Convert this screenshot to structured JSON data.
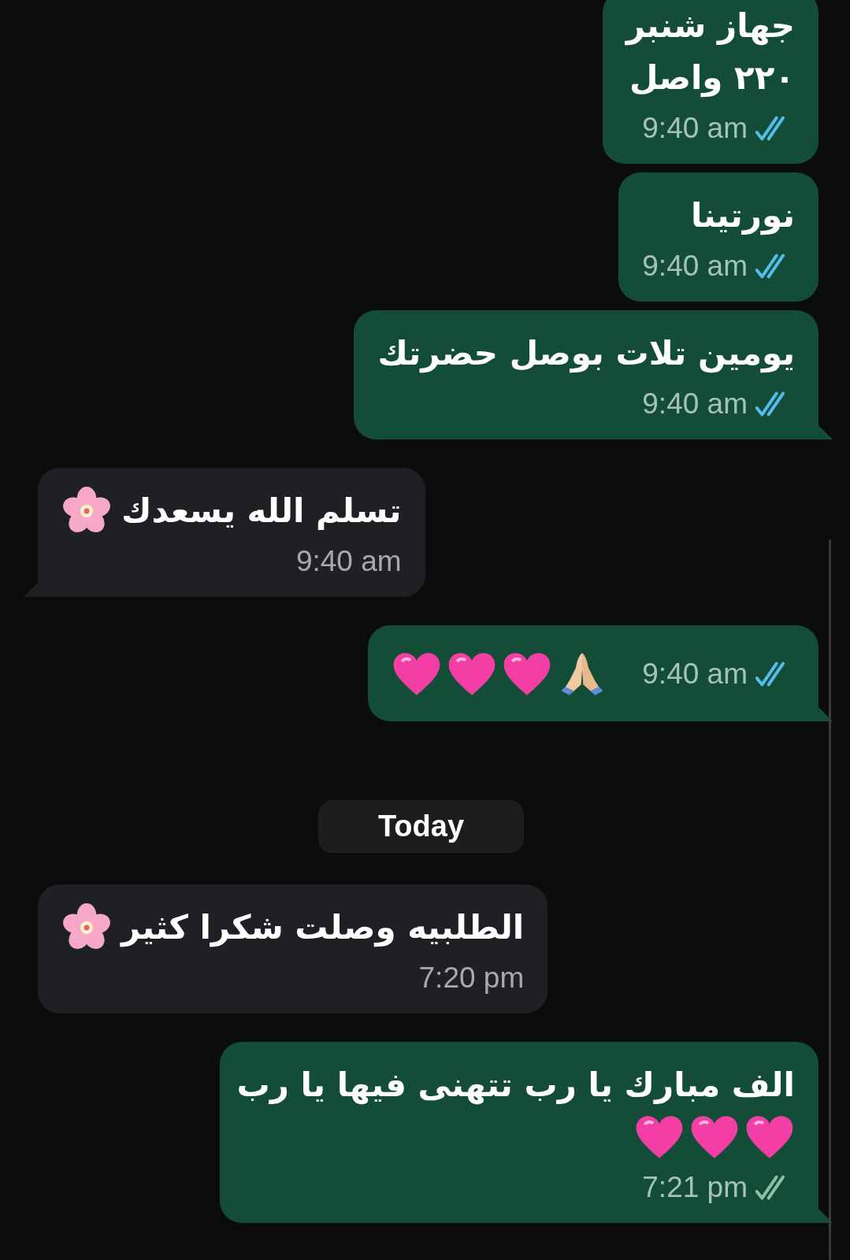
{
  "messages": [
    {
      "kind": "message",
      "outgoing": true,
      "lines": [
        {
          "text": "جهاز شنبر"
        },
        {
          "text": "٢٢٠ واصل"
        }
      ],
      "time": "9:40 am",
      "read": true,
      "tail": false
    },
    {
      "kind": "message",
      "outgoing": true,
      "lines": [
        {
          "text": "نورتينا"
        }
      ],
      "time": "9:40 am",
      "read": true,
      "tail": false
    },
    {
      "kind": "message",
      "outgoing": true,
      "lines": [
        {
          "text": "يومين تلات بوصل حضرتك"
        }
      ],
      "time": "9:40 am",
      "read": true,
      "tail": true
    },
    {
      "kind": "message",
      "outgoing": false,
      "lines": [
        {
          "text": "تسلم الله يسعدك",
          "emojis": [
            {
              "kind": "flower"
            }
          ]
        }
      ],
      "time": "9:40 am",
      "tail": true
    },
    {
      "kind": "message",
      "outgoing": true,
      "inline_emojis": [
        {
          "kind": "heart"
        },
        {
          "kind": "heart"
        },
        {
          "kind": "heart"
        },
        {
          "kind": "praying-hands"
        }
      ],
      "time": "9:40 am",
      "read": true,
      "tail": true
    },
    {
      "kind": "date",
      "label": "Today"
    },
    {
      "kind": "message",
      "outgoing": false,
      "lines": [
        {
          "text": "الطلبيه وصلت شكرا كثير",
          "emojis": [
            {
              "kind": "flower"
            }
          ]
        }
      ],
      "time": "7:20 pm",
      "tail": false
    },
    {
      "kind": "message",
      "outgoing": true,
      "lines": [
        {
          "text": "الف مبارك يا رب تتهنى فيها يا رب"
        },
        {
          "emojis": [
            {
              "kind": "heart"
            },
            {
              "kind": "heart"
            },
            {
              "kind": "heart"
            }
          ]
        }
      ],
      "time": "7:21 pm",
      "read": false,
      "tail": true
    }
  ]
}
